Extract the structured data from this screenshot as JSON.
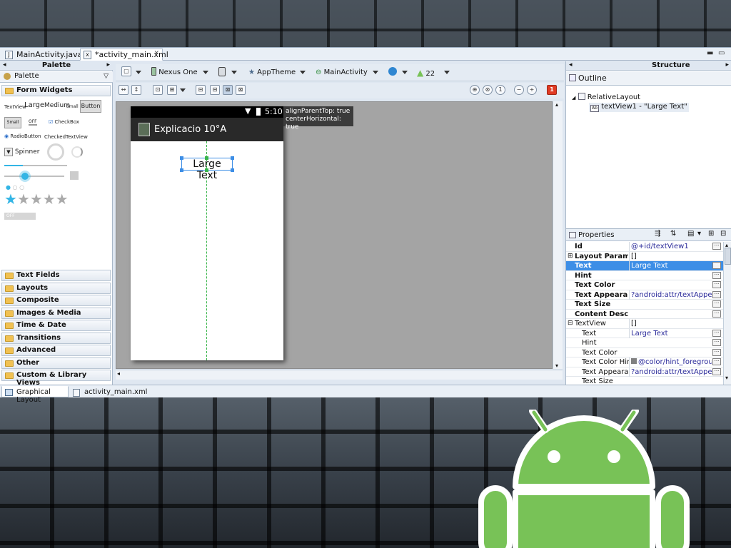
{
  "editor_tabs": [
    {
      "label": "MainActivity.java",
      "icon": "java-file-icon"
    },
    {
      "label": "*activity_main.xml",
      "icon": "xml-file-icon",
      "close": "✕"
    }
  ],
  "palette": {
    "title": "Palette",
    "sub_title": "Palette",
    "form_widgets": "Form Widgets",
    "widgets": {
      "textview": "TextView",
      "large": "Large",
      "medium": "Medium",
      "small": "Small",
      "button": "Button",
      "small_button": "Small",
      "toggle": "OFF",
      "checkbox": "CheckBox",
      "radiobutton": "RadioButton",
      "checkedtextview": "CheckedTextView",
      "spinner": "Spinner",
      "switch": "OFF"
    },
    "categories": [
      "Text Fields",
      "Layouts",
      "Composite",
      "Images & Media",
      "Time & Date",
      "Transitions",
      "Advanced",
      "Other",
      "Custom & Library Views"
    ]
  },
  "toolbar": {
    "device": "Nexus One",
    "theme": "AppTheme",
    "activity": "MainActivity",
    "api": "22",
    "error_badge": "1"
  },
  "phone": {
    "time": "5:10",
    "app_title": "Explicacio 10°A",
    "widget_text": "Large Text"
  },
  "tooltip": {
    "line1": "alignParentTop: true",
    "line2": "centerHorizontal: true"
  },
  "structure": {
    "title": "Structure",
    "outline_title": "Outline",
    "tree": {
      "root": "RelativeLayout",
      "child": "textView1 - \"Large Text\""
    }
  },
  "properties": {
    "title": "Properties",
    "rows": [
      {
        "key": "Id",
        "value": "@+id/textView1"
      },
      {
        "key": "Layout Parame...",
        "value": "[]"
      },
      {
        "key": "Text",
        "value": "Large Text"
      },
      {
        "key": "Hint",
        "value": ""
      },
      {
        "key": "Text Color",
        "value": ""
      },
      {
        "key": "Text Appearan...",
        "value": "?android:attr/textAppear..."
      },
      {
        "key": "Text Size",
        "value": ""
      },
      {
        "key": "Content Descri...",
        "value": ""
      },
      {
        "key": "TextView",
        "value": "[]"
      },
      {
        "key": "Text",
        "value": "Large Text"
      },
      {
        "key": "Hint",
        "value": ""
      },
      {
        "key": "Text Color",
        "value": ""
      },
      {
        "key": "Text Color Hint",
        "value": "@color/hint_foregroun..."
      },
      {
        "key": "Text Appeara...",
        "value": "?android:attr/textAppear..."
      },
      {
        "key": "Text Size",
        "value": ""
      }
    ]
  },
  "bottom_tabs": [
    "Graphical Layout",
    "activity_main.xml"
  ],
  "colors": {
    "selection": "#3d8ee6",
    "android_green": "#78c257",
    "error": "#e03b24",
    "guide_green": "#39b54a"
  }
}
